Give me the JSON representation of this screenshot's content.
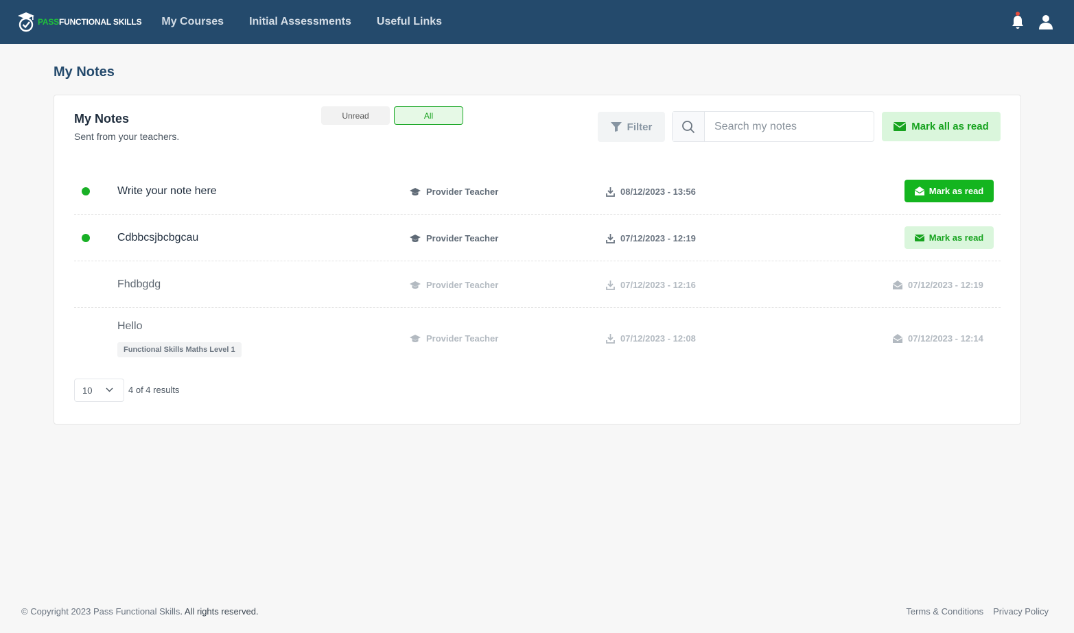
{
  "brand": {
    "pass": "PASS",
    "rest": "FUNCTIONAL SKILLS"
  },
  "nav": {
    "items": [
      "My Courses",
      "Initial Assessments",
      "Useful Links"
    ]
  },
  "page": {
    "title": "My Notes"
  },
  "card": {
    "title": "My Notes",
    "subtitle": "Sent from your teachers.",
    "toggle": {
      "unread": "Unread",
      "all": "All",
      "selected": "All"
    },
    "filter_label": "Filter",
    "search_placeholder": "Search my notes",
    "mark_all_label": "Mark all as read"
  },
  "notes": [
    {
      "text": "Write your note here",
      "teacher": "Provider Teacher",
      "sent": "08/12/2023 - 13:56",
      "unread": true,
      "action": "Mark as read"
    },
    {
      "text": "Cdbbcsjbcbgcau",
      "teacher": "Provider Teacher",
      "sent": "07/12/2023 - 12:19",
      "unread": true,
      "action": "Mark as read"
    },
    {
      "text": "Fhdbgdg",
      "teacher": "Provider Teacher",
      "sent": "07/12/2023 - 12:16",
      "unread": false,
      "read_at": "07/12/2023 - 12:19"
    },
    {
      "text": "Hello",
      "tag": "Functional Skills Maths Level 1",
      "teacher": "Provider Teacher",
      "sent": "07/12/2023 - 12:08",
      "unread": false,
      "read_at": "07/12/2023 - 12:14"
    }
  ],
  "pagination": {
    "per_page": "10",
    "results": "4 of 4 results"
  },
  "footer": {
    "copyright": "© Copyright 2023 Pass Functional Skills",
    "rights": ". All rights reserved.",
    "links": [
      "Terms & Conditions",
      "Privacy Policy"
    ]
  },
  "colors": {
    "navbar": "#244a6c",
    "accent_green": "#14b51f",
    "unread_dot": "#19b026",
    "notification_dot": "#e74c3c"
  },
  "icons": [
    "logo-icon",
    "bell-icon",
    "user-icon",
    "filter-icon",
    "search-icon",
    "envelope-icon",
    "graduation-cap-icon",
    "download-icon",
    "envelope-open-icon",
    "chevron-down-icon"
  ]
}
